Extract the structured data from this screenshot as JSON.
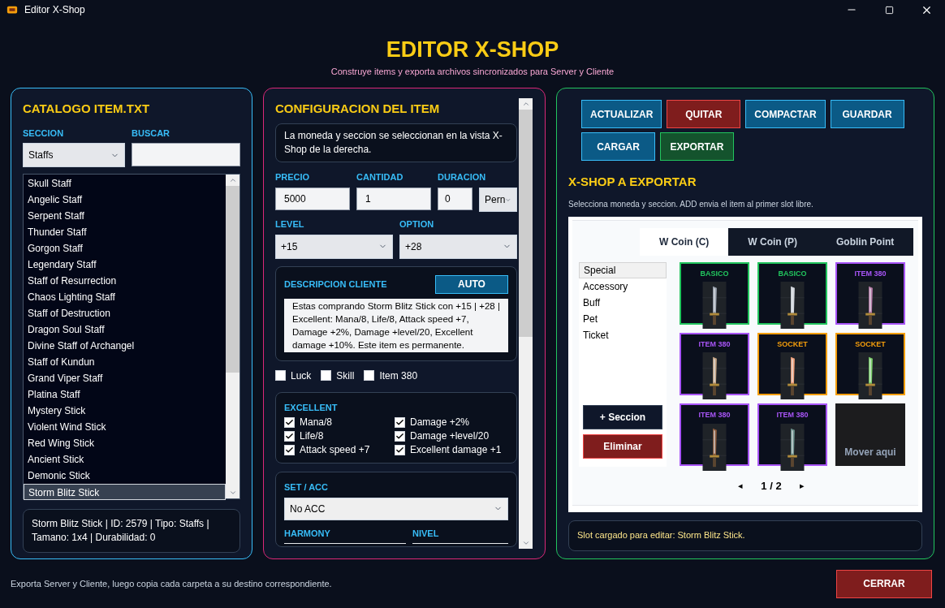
{
  "window": {
    "title": "Editor X-Shop"
  },
  "header": {
    "title": "EDITOR X-SHOP",
    "subtitle": "Construye items y exporta archivos sincronizados para Server y Cliente"
  },
  "catalog": {
    "title": "CATALOGO ITEM.TXT",
    "section_label": "SECCION",
    "section_value": "Staffs",
    "search_label": "BUSCAR",
    "items": [
      {
        "label": "Skull Staff",
        "selected": false
      },
      {
        "label": "Angelic Staff",
        "selected": false
      },
      {
        "label": "Serpent Staff",
        "selected": false
      },
      {
        "label": "Thunder Staff",
        "selected": false
      },
      {
        "label": "Gorgon Staff",
        "selected": false
      },
      {
        "label": "Legendary Staff",
        "selected": false
      },
      {
        "label": "Staff of Resurrection",
        "selected": false
      },
      {
        "label": "Chaos Lighting Staff",
        "selected": false
      },
      {
        "label": "Staff of Destruction",
        "selected": false
      },
      {
        "label": "Dragon Soul Staff",
        "selected": false
      },
      {
        "label": "Divine Staff of Archangel",
        "selected": false
      },
      {
        "label": "Staff of Kundun",
        "selected": false
      },
      {
        "label": "Grand Viper Staff",
        "selected": false
      },
      {
        "label": "Platina Staff",
        "selected": false
      },
      {
        "label": "Mystery Stick",
        "selected": false
      },
      {
        "label": "Violent Wind Stick",
        "selected": false
      },
      {
        "label": "Red Wing Stick",
        "selected": false
      },
      {
        "label": "Ancient Stick",
        "selected": false
      },
      {
        "label": "Demonic Stick",
        "selected": false
      },
      {
        "label": "Storm Blitz Stick",
        "selected": true
      }
    ],
    "info": "Storm Blitz Stick | ID: 2579 | Tipo: Staffs | Tamano: 1x4 | Durabilidad: 0"
  },
  "config": {
    "title": "CONFIGURACION DEL ITEM",
    "note": "La moneda y seccion se seleccionan en la vista X-Shop de la derecha.",
    "price": {
      "label": "PRECIO",
      "value": "5000"
    },
    "quantity": {
      "label": "CANTIDAD",
      "value": "1"
    },
    "duration": {
      "label": "DURACION",
      "value": "0",
      "unit": "Pern"
    },
    "level": {
      "label": "LEVEL",
      "value": "+15"
    },
    "option": {
      "label": "OPTION",
      "value": "+28"
    },
    "description": {
      "label": "DESCRIPCION CLIENTE",
      "button": "AUTO",
      "text": "Estas comprando Storm Blitz Stick con +15 | +28 | Excellent: Mana/8, Life/8, Attack speed +7, Damage +2%, Damage +level/20, Excellent damage +10%. Este item es permanente."
    },
    "flags": [
      {
        "label": "Luck",
        "checked": false
      },
      {
        "label": "Skill",
        "checked": false
      },
      {
        "label": "Item 380",
        "checked": false
      }
    ],
    "excellent": {
      "label": "EXCELLENT",
      "options": [
        {
          "label": "Mana/8",
          "checked": true
        },
        {
          "label": "Damage +2%",
          "checked": true
        },
        {
          "label": "Life/8",
          "checked": true
        },
        {
          "label": "Damage +level/20",
          "checked": true
        },
        {
          "label": "Attack speed +7",
          "checked": true
        },
        {
          "label": "Excellent damage +1",
          "checked": true
        }
      ]
    },
    "set_acc": {
      "label": "SET / ACC",
      "value": "No ACC",
      "harmony_label": "HARMONY",
      "nivel_label": "NIVEL"
    }
  },
  "xshop": {
    "buttons": [
      {
        "label": "ACTUALIZAR",
        "kind": "blue"
      },
      {
        "label": "QUITAR",
        "kind": "red"
      },
      {
        "label": "COMPACTAR",
        "kind": "blue"
      },
      {
        "label": "GUARDAR",
        "kind": "blue"
      },
      {
        "label": "CARGAR",
        "kind": "blue"
      },
      {
        "label": "EXPORTAR",
        "kind": "green"
      }
    ],
    "title": "X-SHOP A EXPORTAR",
    "description": "Selecciona moneda y seccion. ADD envia el item al primer slot libre.",
    "tabs": [
      {
        "label": "W Coin (C)",
        "selected": true
      },
      {
        "label": "W Coin (P)",
        "selected": false
      },
      {
        "label": "Goblin Point",
        "selected": false
      }
    ],
    "sections": [
      {
        "label": "Special",
        "selected": true
      },
      {
        "label": "Accessory",
        "selected": false
      },
      {
        "label": "Buff",
        "selected": false
      },
      {
        "label": "Pet",
        "selected": false
      },
      {
        "label": "Ticket",
        "selected": false
      }
    ],
    "add_section": "+ Seccion",
    "delete": "Eliminar",
    "slots": [
      {
        "kind": "item",
        "label": "BASICO",
        "color": "#22c55e"
      },
      {
        "kind": "item",
        "label": "BASICO",
        "color": "#22c55e"
      },
      {
        "kind": "item",
        "label": "ITEM 380",
        "color": "#a855f7"
      },
      {
        "kind": "item",
        "label": "ITEM 380",
        "color": "#a855f7"
      },
      {
        "kind": "item",
        "label": "SOCKET",
        "color": "#f59e0b"
      },
      {
        "kind": "item",
        "label": "SOCKET",
        "color": "#f59e0b"
      },
      {
        "kind": "item",
        "label": "ITEM 380",
        "color": "#a855f7"
      },
      {
        "kind": "item",
        "label": "ITEM 380",
        "color": "#a855f7"
      },
      {
        "kind": "empty",
        "label": "Mover aqui"
      }
    ],
    "prev": "◂",
    "page": "1 / 2",
    "next": "▸",
    "status": "Slot cargado para editar: Storm Blitz Stick."
  },
  "footer": {
    "text": "Exporta Server y Cliente, luego copia cada carpeta a su destino correspondiente.",
    "button": "CERRAR"
  }
}
